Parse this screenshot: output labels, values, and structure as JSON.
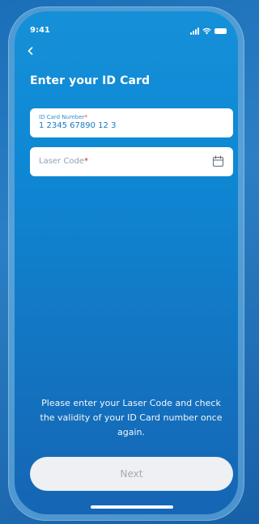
{
  "status_bar": {
    "time": "9:41"
  },
  "header": {
    "title": "Enter your ID Card"
  },
  "id_field": {
    "label": "ID Card Number",
    "required_mark": "*",
    "value": "1 2345 67890 12 3"
  },
  "laser_field": {
    "placeholder": "Laser Code",
    "required_mark": "*",
    "icon": "calendar-icon"
  },
  "help_text": "Please enter your Laser Code and check the validity of your ID Card number once again.",
  "next_button": {
    "label": "Next",
    "enabled": false
  },
  "colors": {
    "primary": "#1590d8",
    "accent_text": "#1a78c2",
    "required": "#d8232a",
    "disabled_button_bg": "#eef0f3",
    "disabled_button_text": "#a2aab3"
  }
}
